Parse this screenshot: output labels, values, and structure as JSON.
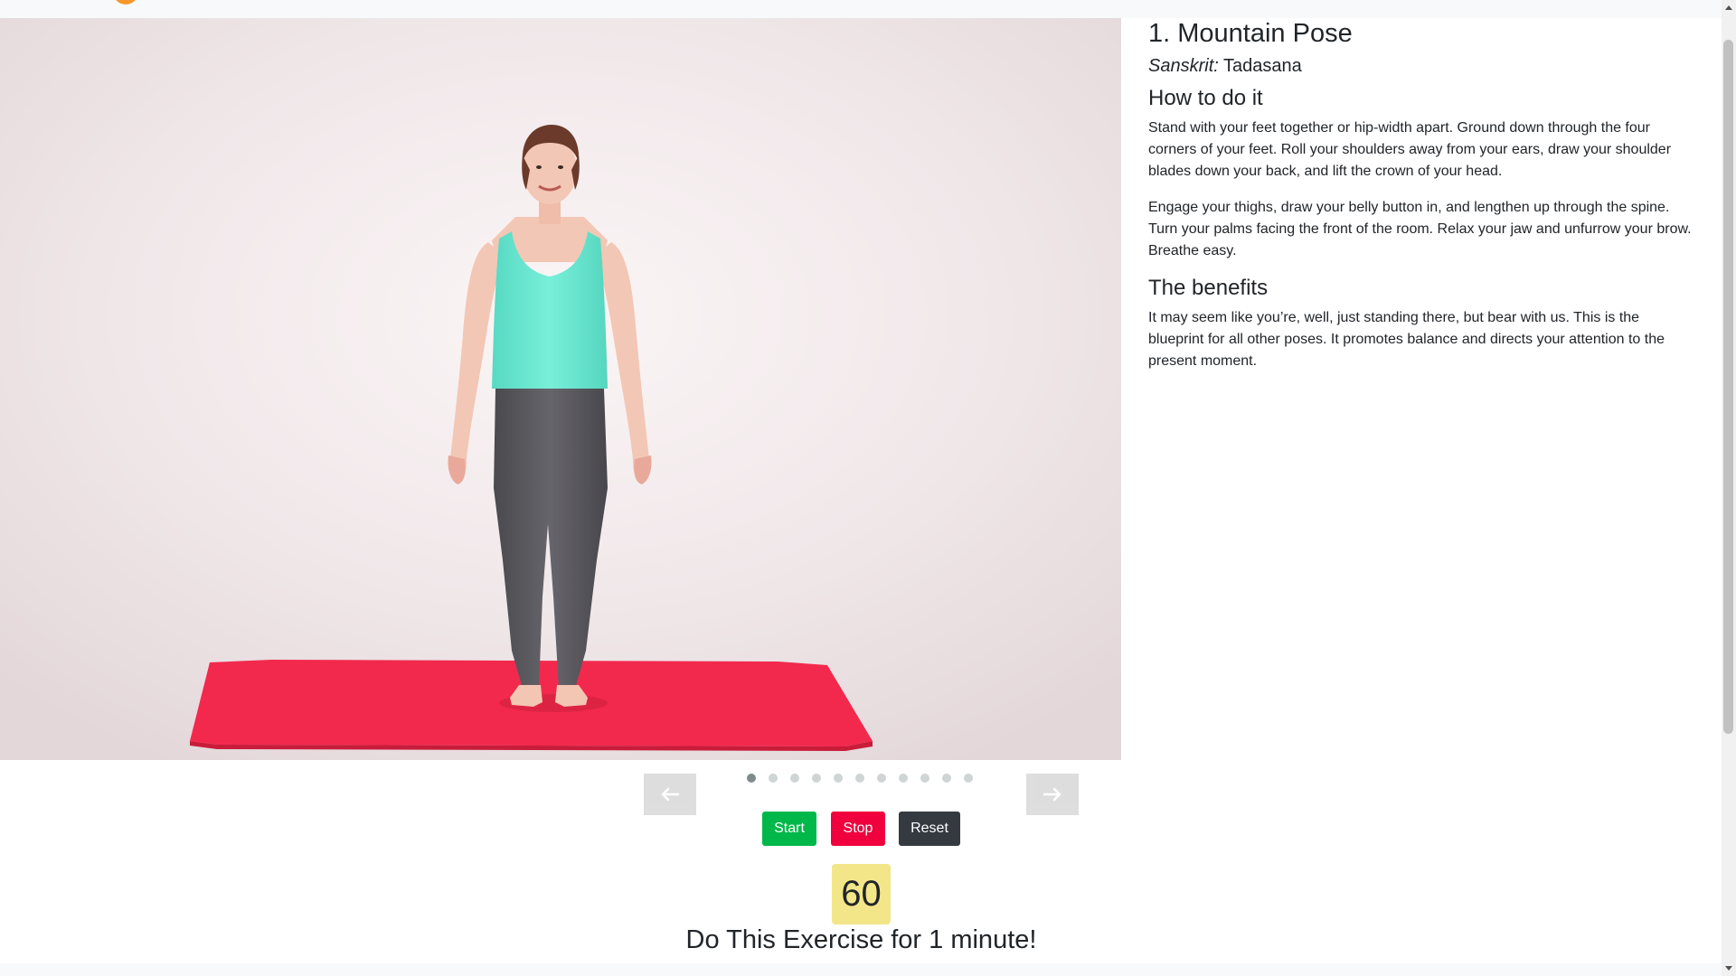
{
  "pose": {
    "title": "1. Mountain Pose",
    "sanskrit_label": "Sanskrit:",
    "sanskrit_name": "Tadasana",
    "photo_alt": "Woman in teal tank top standing in mountain pose on a red yoga mat",
    "how_heading": "How to do it",
    "how_paragraphs": [
      "Stand with your feet together or hip-width apart. Ground down through the four corners of your feet. Roll your shoulders away from your ears, draw your shoulder blades down your back, and lift the crown of your head.",
      "Engage your thighs, draw your belly button in, and lengthen up through the spine. Turn your palms facing the front of the room. Relax your jaw and unfurrow your brow. Breathe easy."
    ],
    "benefits_heading": "The benefits",
    "benefits_paragraph": "It may seem like you’re, well, just standing there, but bear with us. This is the blueprint for all other poses. It promotes balance and directs your attention to the present moment."
  },
  "carousel": {
    "slide_count": 11,
    "active_index": 0,
    "prev_icon": "arrow-left-icon",
    "next_icon": "arrow-right-icon"
  },
  "controls": {
    "start_label": "Start",
    "stop_label": "Stop",
    "reset_label": "Reset"
  },
  "timer": {
    "value": "60",
    "instruction": "Do This Exercise for 1 minute!"
  },
  "colors": {
    "start": "#00b84a",
    "stop": "#f0003c",
    "reset": "#343a40",
    "timer_bg": "#f3e689",
    "logo_accent": "#f7962b",
    "mat": "#f2294d",
    "tank_top": "#6fe8d2"
  }
}
